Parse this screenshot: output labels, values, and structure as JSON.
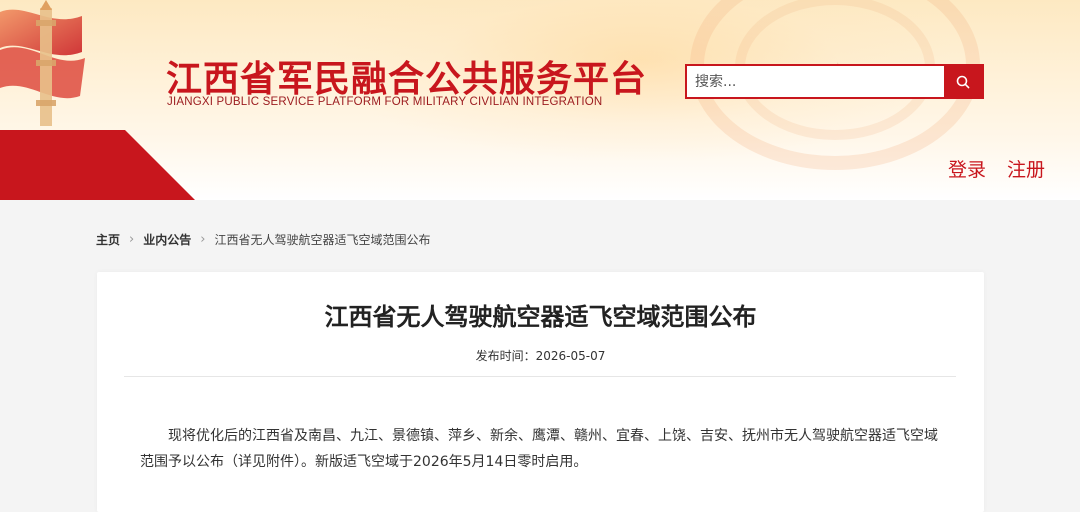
{
  "header": {
    "site_title_cn": "江西省军民融合公共服务平台",
    "site_title_en": "JIANGXI PUBLIC SERVICE PLATFORM FOR MILITARY CIVILIAN INTEGRATION",
    "search": {
      "placeholder": "搜索..."
    },
    "auth": {
      "login": "登录",
      "register": "注册"
    },
    "colors": {
      "brand_red": "#c8161d"
    }
  },
  "breadcrumb": {
    "home": "主页",
    "section": "业内公告",
    "current": "江西省无人驾驶航空器适飞空域范围公布"
  },
  "article": {
    "title": "江西省无人驾驶航空器适飞空域范围公布",
    "publish_label": "发布时间：",
    "publish_date": "2026-05-07",
    "body": "现将优化后的江西省及南昌、九江、景德镇、萍乡、新余、鹰潭、赣州、宜春、上饶、吉安、抚州市无人驾驶航空器适飞空域范围予以公布（详见附件）。新版适飞空域于2026年5月14日零时启用。"
  }
}
